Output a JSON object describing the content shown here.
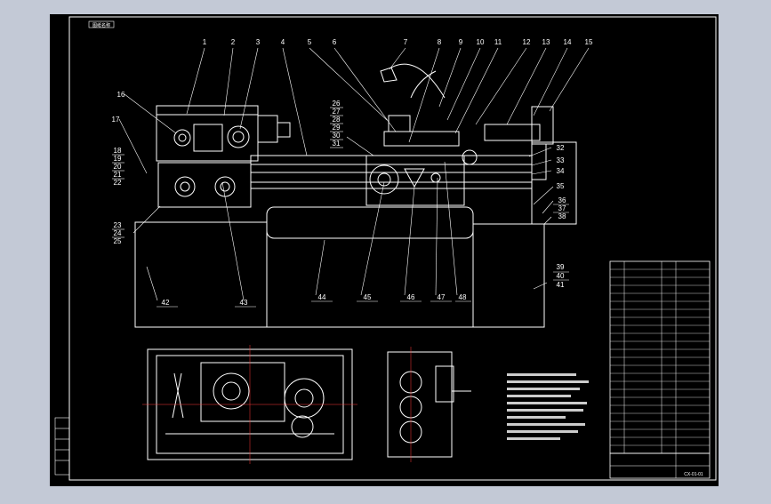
{
  "colors": {
    "background": "#c3c9d6",
    "paper": "#000000",
    "line": "#ffffff",
    "accent": "#ff3b3b"
  },
  "sheet_tag": "图纸名称",
  "callouts_top": [
    "1",
    "2",
    "3",
    "4",
    "5",
    "6",
    "7",
    "8",
    "9",
    "10",
    "11",
    "12",
    "13",
    "14",
    "15"
  ],
  "callout_16": "16",
  "callout_17": "17",
  "group_left_a": [
    "18",
    "19",
    "20",
    "21",
    "22"
  ],
  "group_left_b": [
    "23",
    "24",
    "25"
  ],
  "group_mid": [
    "26",
    "27",
    "28",
    "29",
    "30",
    "31"
  ],
  "callouts_right": [
    "32",
    "33",
    "34",
    "35",
    "36",
    "37",
    "38"
  ],
  "group_right_bottom": [
    "39",
    "40",
    "41"
  ],
  "callouts_bottom": [
    "42",
    "43",
    "44",
    "45",
    "46",
    "47",
    "48"
  ],
  "title_block": {
    "drawing_number": "CX-01-01"
  }
}
